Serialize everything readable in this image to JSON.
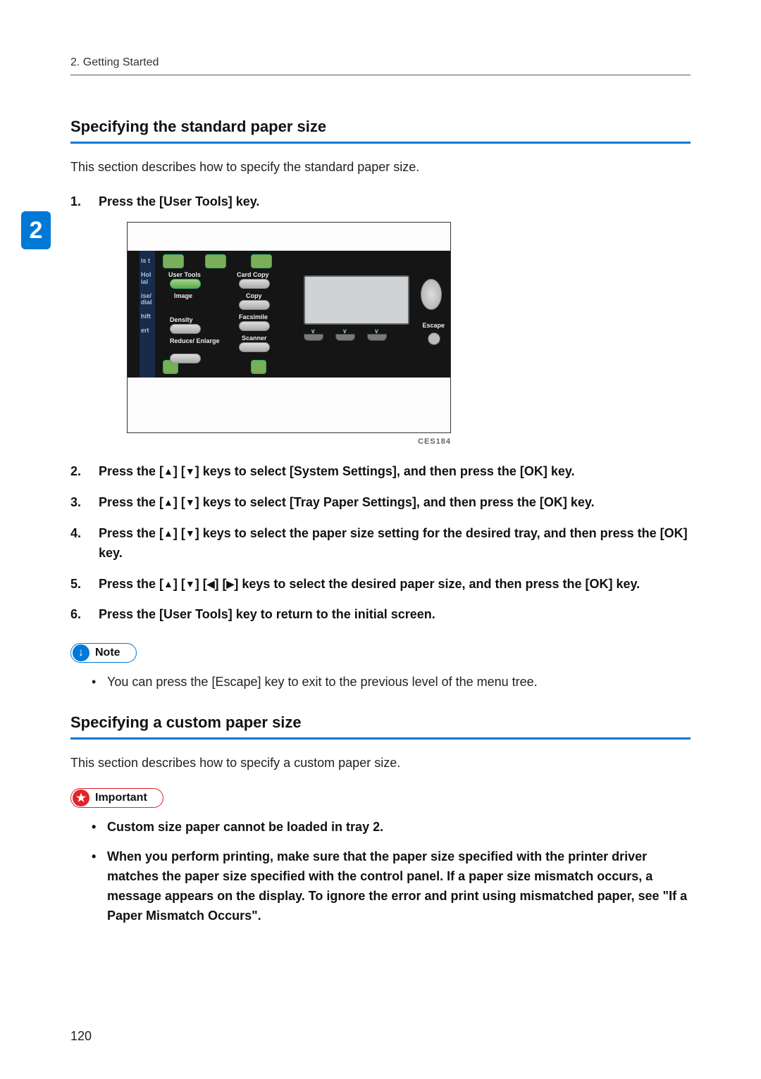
{
  "header": {
    "running": "2. Getting Started"
  },
  "sideTab": "2",
  "section1": {
    "title": "Specifying the standard paper size",
    "intro": "This section describes how to specify the standard paper size.",
    "figure": {
      "caption": "CES184",
      "labels": {
        "userTools": "User Tools",
        "image": "Image",
        "density": "Density",
        "reduceEnlarge": "Reduce/\nEnlarge",
        "cardCopy": "Card Copy",
        "copy": "Copy",
        "facsimile": "Facsimile",
        "scanner": "Scanner",
        "escape": "Escape",
        "strip": [
          "is t",
          "Hol\nial",
          "ise/\ndial",
          "hift",
          "ert"
        ]
      }
    },
    "steps": {
      "s1": "Press the [User Tools] key.",
      "s2a": "Press the [",
      "s2b": "] [",
      "s2c": "] keys to select [System Settings], and then press the [OK] key.",
      "s3a": "Press the [",
      "s3b": "] [",
      "s3c": "] keys to select [Tray Paper Settings], and then press the [OK] key.",
      "s4a": "Press the [",
      "s4b": "] [",
      "s4c": "] keys to select the paper size setting for the desired tray, and then press the [OK] key.",
      "s5a": "Press the [",
      "s5b": "] [",
      "s5c": "] [",
      "s5d": "] [",
      "s5e": "] keys to select the desired paper size, and then press the [OK] key.",
      "s6": "Press the [User Tools] key to return to the initial screen."
    },
    "note": {
      "label": "Note",
      "items": [
        "You can press the [Escape] key to exit to the previous level of the menu tree."
      ]
    }
  },
  "section2": {
    "title": "Specifying a custom paper size",
    "intro": "This section describes how to specify a custom paper size.",
    "important": {
      "label": "Important",
      "items": [
        "Custom size paper cannot be loaded in tray 2.",
        "When you perform printing, make sure that the paper size specified with the printer driver matches the paper size specified with the control panel. If a paper size mismatch occurs, a message appears on the display. To ignore the error and print using mismatched paper, see \"If a Paper Mismatch Occurs\"."
      ]
    }
  },
  "icons": {
    "up": "▲",
    "down": "▼",
    "left": "◀",
    "right": "▶",
    "noteGlyph": "↓",
    "importantGlyph": "★"
  },
  "pageNumber": "120"
}
